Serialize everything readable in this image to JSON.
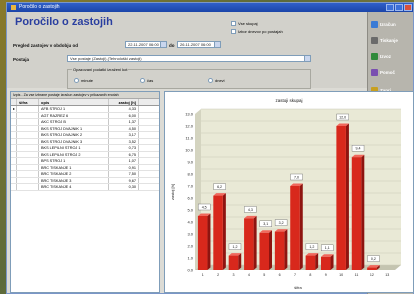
{
  "window": {
    "title": "Poročilo o zastojih"
  },
  "header": {
    "title": "Poročilo o zastojih",
    "period_label": "Pregled zastojev v obdobju od",
    "date_from": "22.11.2007  06:00",
    "to_label": "do",
    "date_to": "26.11.2007  06:00",
    "station_label": "Postaja",
    "station_value": "Vse postaje (Zastoji),(Tehnološki zastoji)",
    "check1": "Vse skupaj",
    "check2": "Izbor dnevov po postajah",
    "group_label": "Opazovani podatki izraženi kot",
    "radio1": "minute",
    "radio2": "čas",
    "radio3": "dnevi"
  },
  "sidebar": {
    "items": [
      {
        "label": "Izračun",
        "color": "#3a7bd5"
      },
      {
        "label": "Tiskanje",
        "color": "#6a6a6a"
      },
      {
        "label": "Izvoz",
        "color": "#2f8a3a"
      },
      {
        "label": "Pomoč",
        "color": "#7a4fb0"
      },
      {
        "label": "Zapri",
        "color": "#c8a020"
      }
    ]
  },
  "grid": {
    "caption": "Izpis - Za vse izbrane postaje izračun zastojev v prikazanih enotah",
    "columns": [
      "šifra",
      "opis",
      "zastoj [h]"
    ],
    "rows": [
      [
        "",
        "AFB STROJ 1",
        "4,33"
      ],
      [
        "",
        "AGT RAZREZ 6",
        "6,00"
      ],
      [
        "",
        "AKC STROJ B",
        "1,37"
      ],
      [
        "",
        "BKS STROJ DVAJNIK 1",
        "4,50"
      ],
      [
        "",
        "BKS STROJ DVAJNIK 2",
        "3,17"
      ],
      [
        "",
        "BKS STROJ DVAJNIK 3",
        "3,52"
      ],
      [
        "",
        "BKS LEPILNI STROJ 1",
        "0,73"
      ],
      [
        "",
        "BKS LEPILNI STROJ 2",
        "6,75"
      ],
      [
        "",
        "BPS STROJ 1",
        "1,07"
      ],
      [
        "",
        "BRC TISKANJE 1",
        "0,91"
      ],
      [
        "",
        "BRC TISKANJE 2",
        "7,50"
      ],
      [
        "",
        "BRC TISKANJE 3",
        "9,67"
      ],
      [
        "",
        "BRC TISKANJE 4",
        "0,30"
      ]
    ]
  },
  "chart_data": {
    "type": "bar",
    "title": "zastoji skupaj",
    "xlabel": "šifra",
    "ylabel": "zastoj [h]",
    "ylim": [
      0,
      13
    ],
    "yticks": [
      0,
      1,
      2,
      3,
      4,
      5,
      6,
      7,
      8,
      9,
      10,
      11,
      12,
      13
    ],
    "categories": [
      "1",
      "2",
      "3",
      "4",
      "5",
      "6",
      "7",
      "8",
      "9",
      "10",
      "11",
      "12",
      "13"
    ],
    "values": [
      4.5,
      6.2,
      1.2,
      4.3,
      3.1,
      3.2,
      7.0,
      1.2,
      1.1,
      12.0,
      9.4,
      0.2
    ],
    "data_labels": [
      "4,5",
      "6,2",
      "1,2",
      "4,3",
      "3,1",
      "3,2",
      "7,0",
      "1,2",
      "1,1",
      "12,0",
      "9,4",
      "0,2"
    ],
    "colors": {
      "bar": "#d8281c",
      "bar_dark": "#8e1410",
      "grid": "#c9c9b8",
      "wall": "#e9e9d6"
    },
    "grid": true
  }
}
